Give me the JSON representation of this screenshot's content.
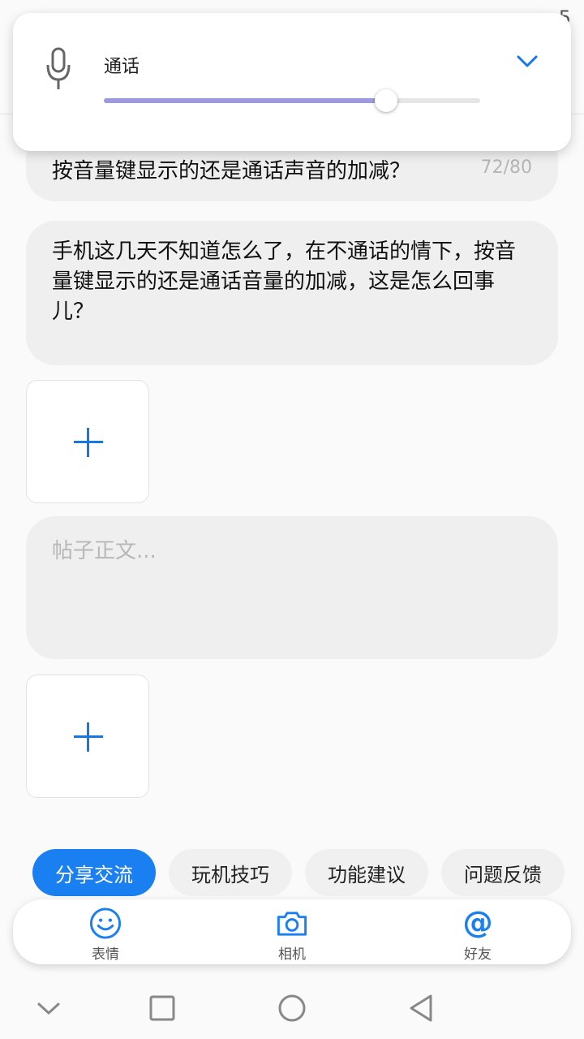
{
  "status": {
    "time": "5"
  },
  "volume_panel": {
    "stream_label": "通话",
    "level": 0.75,
    "accent": "#9c98e3",
    "icons": {
      "stream": "microphone-icon",
      "expand": "chevron-down-icon"
    }
  },
  "post": {
    "title": "按音量键显示的还是通话声音的加减？",
    "title_counter": "72/80",
    "question": "手机这几天不知道怎么了，在不通话的情下，按音量键显示的还是通话音量的加减，这是怎么回事儿？",
    "body_placeholder": "帖子正文..."
  },
  "categories": [
    {
      "label": "分享交流",
      "active": true
    },
    {
      "label": "玩机技巧",
      "active": false
    },
    {
      "label": "功能建议",
      "active": false
    },
    {
      "label": "问题反馈",
      "active": false
    }
  ],
  "toolbar": {
    "items": [
      {
        "label": "表情",
        "icon": "smiley-icon"
      },
      {
        "label": "相机",
        "icon": "camera-icon"
      },
      {
        "label": "好友",
        "icon": "at-icon"
      }
    ]
  },
  "colors": {
    "accent_blue": "#1a7ff0",
    "field_bg": "#efefef"
  }
}
